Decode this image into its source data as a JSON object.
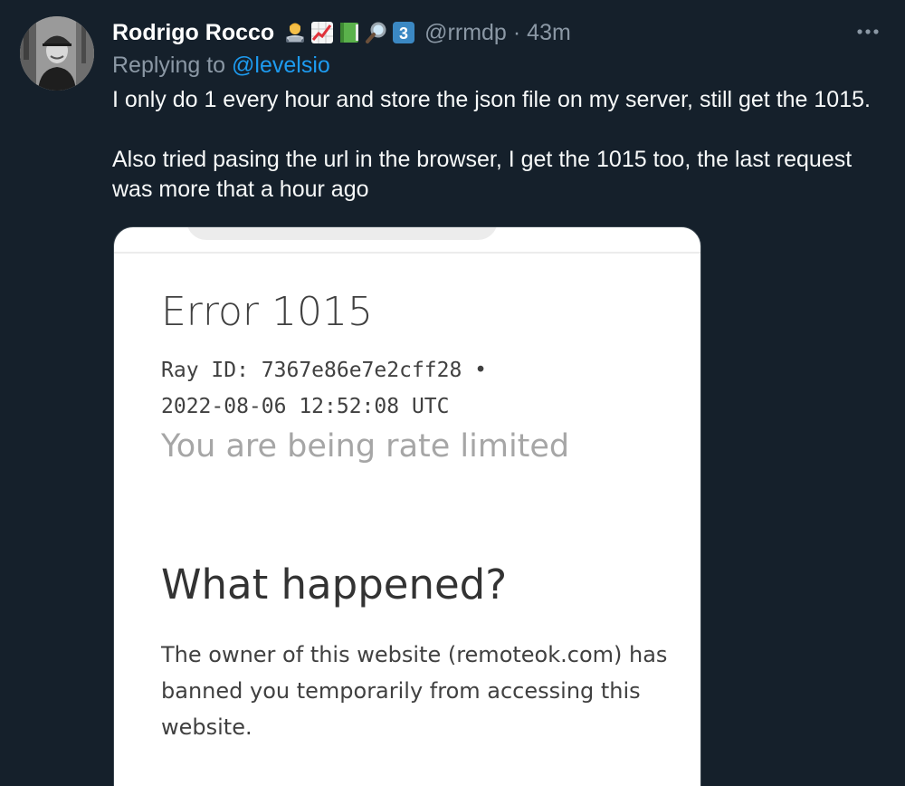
{
  "author": {
    "display_name": "Rodrigo Rocco",
    "name_emojis": [
      "technologist-icon",
      "chart-increasing-icon",
      "green-book-icon",
      "magnifying-glass-icon",
      "keycap-3-icon"
    ],
    "keycap_digit": "3",
    "handle": "@rrmdp",
    "separator": "·",
    "time": "43m"
  },
  "reply": {
    "prefix": "Replying to",
    "mention": "@levelsio"
  },
  "tweet": {
    "paragraph_1": "I only do 1 every hour and store the json file on my server, still get the 1015.",
    "paragraph_2": "Also tried pasing the url in the browser, I get the 1015 too, the last request was more that a hour ago"
  },
  "media": {
    "error_title": "Error 1015",
    "ray_id_line": "Ray ID: 7367e86e7e2cff28 •",
    "timestamp_line": "2022-08-06 12:52:08 UTC",
    "rate_limited": "You are being rate limited",
    "what_happened": "What happened?",
    "description": "The owner of this website (remoteok.com) has banned you temporarily from accessing this website."
  },
  "colors": {
    "background": "#15202b",
    "primary_text": "#f7f9f9",
    "secondary_text": "#8b98a5",
    "link": "#1d9bf0"
  }
}
